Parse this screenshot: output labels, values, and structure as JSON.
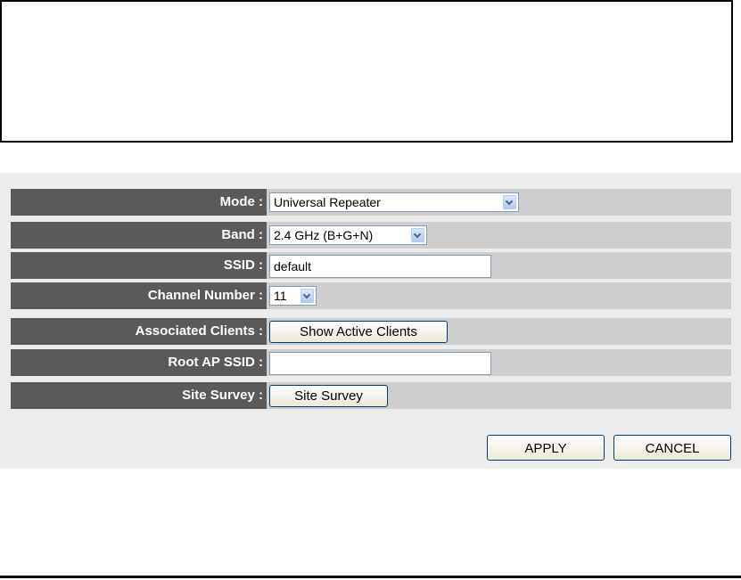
{
  "form": {
    "mode": {
      "label": "Mode :",
      "value": "Universal Repeater"
    },
    "band": {
      "label": "Band :",
      "value": "2.4 GHz (B+G+N)"
    },
    "ssid": {
      "label": "SSID :",
      "value": "default"
    },
    "channel": {
      "label": "Channel Number :",
      "value": "11"
    },
    "associated_clients": {
      "label": "Associated Clients :",
      "button": "Show Active Clients"
    },
    "root_ap_ssid": {
      "label": "Root AP SSID :",
      "value": ""
    },
    "site_survey": {
      "label": "Site Survey :",
      "button": "Site Survey"
    }
  },
  "actions": {
    "apply": "APPLY",
    "cancel": "CANCEL"
  },
  "colors": {
    "label_bg": "#5a5a5a",
    "value_bg": "#cecece",
    "panel_bg": "#ececec"
  }
}
